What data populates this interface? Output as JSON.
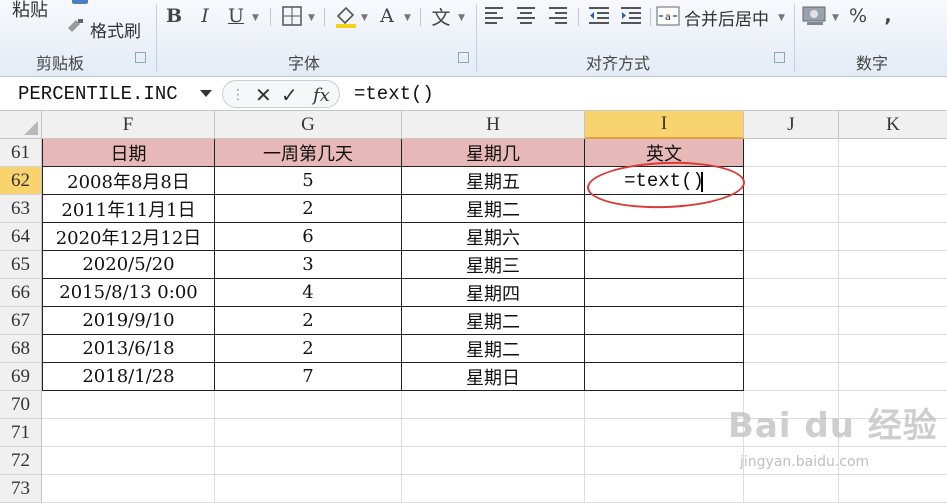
{
  "ribbon": {
    "clipboard": {
      "paste_label": "粘贴",
      "format_painter_label": "格式刷",
      "group_label": "剪贴板"
    },
    "font": {
      "bold_label": "B",
      "italic_label": "I",
      "underline_label": "U",
      "font_color_label": "A",
      "phonetic_label": "文",
      "group_label": "字体"
    },
    "alignment": {
      "merge_center_label": "合并后居中",
      "group_label": "对齐方式"
    },
    "number": {
      "percent_label": "%",
      "comma_label": ",",
      "group_label": "数字"
    }
  },
  "formula_bar": {
    "name_box": "PERCENTILE.INC",
    "cancel_label": "✕",
    "enter_label": "✓",
    "fx_label": "fx",
    "formula": "=text()"
  },
  "columns": [
    {
      "letter": "F",
      "selected": false
    },
    {
      "letter": "G",
      "selected": false
    },
    {
      "letter": "H",
      "selected": false
    },
    {
      "letter": "I",
      "selected": true
    },
    {
      "letter": "J",
      "selected": false
    },
    {
      "letter": "K",
      "selected": false
    }
  ],
  "rows": [
    {
      "num": "61",
      "cells": [
        "日期",
        "一周第几天",
        "星期几",
        "英文"
      ],
      "header": true
    },
    {
      "num": "62",
      "cells": [
        "2008年8月8日",
        "5",
        "星期五",
        "=text()"
      ],
      "selected": true
    },
    {
      "num": "63",
      "cells": [
        "2011年11月1日",
        "2",
        "星期二",
        ""
      ]
    },
    {
      "num": "64",
      "cells": [
        "2020年12月12日",
        "6",
        "星期六",
        ""
      ]
    },
    {
      "num": "65",
      "cells": [
        "2020/5/20",
        "3",
        "星期三",
        ""
      ]
    },
    {
      "num": "66",
      "cells": [
        "2015/8/13 0:00",
        "4",
        "星期四",
        ""
      ]
    },
    {
      "num": "67",
      "cells": [
        "2019/9/10",
        "2",
        "星期二",
        ""
      ]
    },
    {
      "num": "68",
      "cells": [
        "2013/6/18",
        "2",
        "星期二",
        ""
      ]
    },
    {
      "num": "69",
      "cells": [
        "2018/1/28",
        "7",
        "星期日",
        ""
      ]
    },
    {
      "num": "70",
      "cells": [
        "",
        "",
        "",
        ""
      ]
    },
    {
      "num": "71",
      "cells": [
        "",
        "",
        "",
        ""
      ]
    },
    {
      "num": "72",
      "cells": [
        "",
        "",
        "",
        ""
      ]
    },
    {
      "num": "73",
      "cells": [
        "",
        "",
        "",
        ""
      ]
    }
  ],
  "watermark": {
    "logo": "Bai du 经验",
    "url": "jingyan.baidu.com"
  },
  "colors": {
    "header_fill": "#e6b8b7",
    "selected_header": "#f9d36e",
    "annotation": "#d93a37"
  }
}
